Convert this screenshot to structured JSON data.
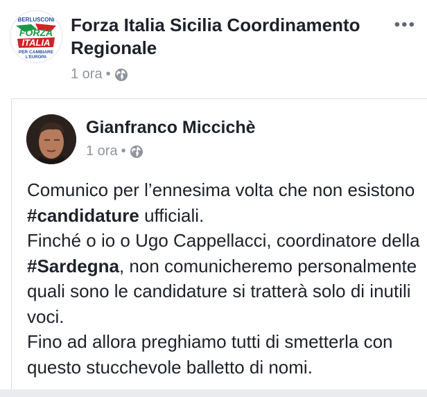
{
  "header": {
    "page_name": "Forza Italia Sicilia Coordinamento Regionale",
    "time": "1 ora",
    "separator": "•",
    "privacy_icon": "globe-icon",
    "more_icon": "more-options-icon",
    "more_glyph": "•••",
    "logo": {
      "top_text": "BERLUSCONI",
      "main_line1": "FORZA",
      "main_line2": "ITALIA",
      "bottom_line1": "PER CAMBIARE",
      "bottom_line2": "L'EUROPA"
    }
  },
  "shared_post": {
    "author_name": "Gianfranco Miccichè",
    "time": "1 ora",
    "separator": "•",
    "privacy_icon": "globe-icon",
    "paragraphs": [
      {
        "before": "Comunico per l’ennesima volta che non esistono ",
        "hashtag_symbol": "#",
        "hashtag": "candidature",
        "after": " ufficiali."
      },
      {
        "before": "Finché o io o Ugo Cappellacci, coordinatore della ",
        "hashtag_symbol": "#",
        "hashtag": "Sardegna",
        "after": ", non comunicheremo personalmente quali sono le candidature si tratterà solo di inutili voci."
      },
      {
        "text": "Fino ad allora preghiamo tutti di smetterla con questo stucchevole balletto di nomi."
      }
    ]
  },
  "colors": {
    "text": "#1d2129",
    "meta": "#90949c",
    "border": "#dadde1",
    "logo_green": "#1a9a47",
    "logo_red": "#d32128",
    "logo_blue": "#1f4e9c"
  }
}
